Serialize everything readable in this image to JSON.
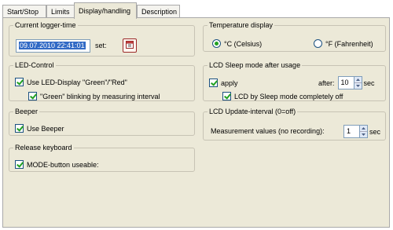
{
  "tabs": [
    {
      "label": "Start/Stop"
    },
    {
      "label": "Limits"
    },
    {
      "label": "Display/handling"
    },
    {
      "label": "Description"
    }
  ],
  "logger_time": {
    "legend": "Current logger-time",
    "value": "09.07.2010 22:41:01",
    "set_label": "set:",
    "button_icon": "calendar-icon"
  },
  "led": {
    "legend": "LED-Control",
    "use_led_label": "Use LED-Display \"Green\"/\"Red\"",
    "use_led_checked": true,
    "blink_label": "\"Green\" blinking by measuring interval",
    "blink_checked": true
  },
  "beeper": {
    "legend": "Beeper",
    "use_beeper_label": "Use Beeper",
    "use_beeper_checked": true
  },
  "release": {
    "legend": "Release keyboard",
    "mode_label": "MODE-button useable:",
    "mode_checked": true
  },
  "temperature": {
    "legend": "Temperature display",
    "celsius_label": "°C (Celsius)",
    "fahrenheit_label": "°F (Fahrenheit)",
    "selected": "celsius"
  },
  "lcd_sleep": {
    "legend": "LCD Sleep mode after usage",
    "apply_label": "apply",
    "apply_checked": true,
    "after_label": "after:",
    "after_value": "10",
    "unit": "sec",
    "complete_label": "LCD by Sleep mode completely off",
    "complete_checked": true
  },
  "lcd_update": {
    "legend": "LCD Update-interval (0=off)",
    "measure_label": "Measurement values (no recording):",
    "value": "1",
    "unit": "sec"
  },
  "colors": {
    "panel": "#ece9d8",
    "check": "#21a121",
    "selection": "#316ac5"
  }
}
